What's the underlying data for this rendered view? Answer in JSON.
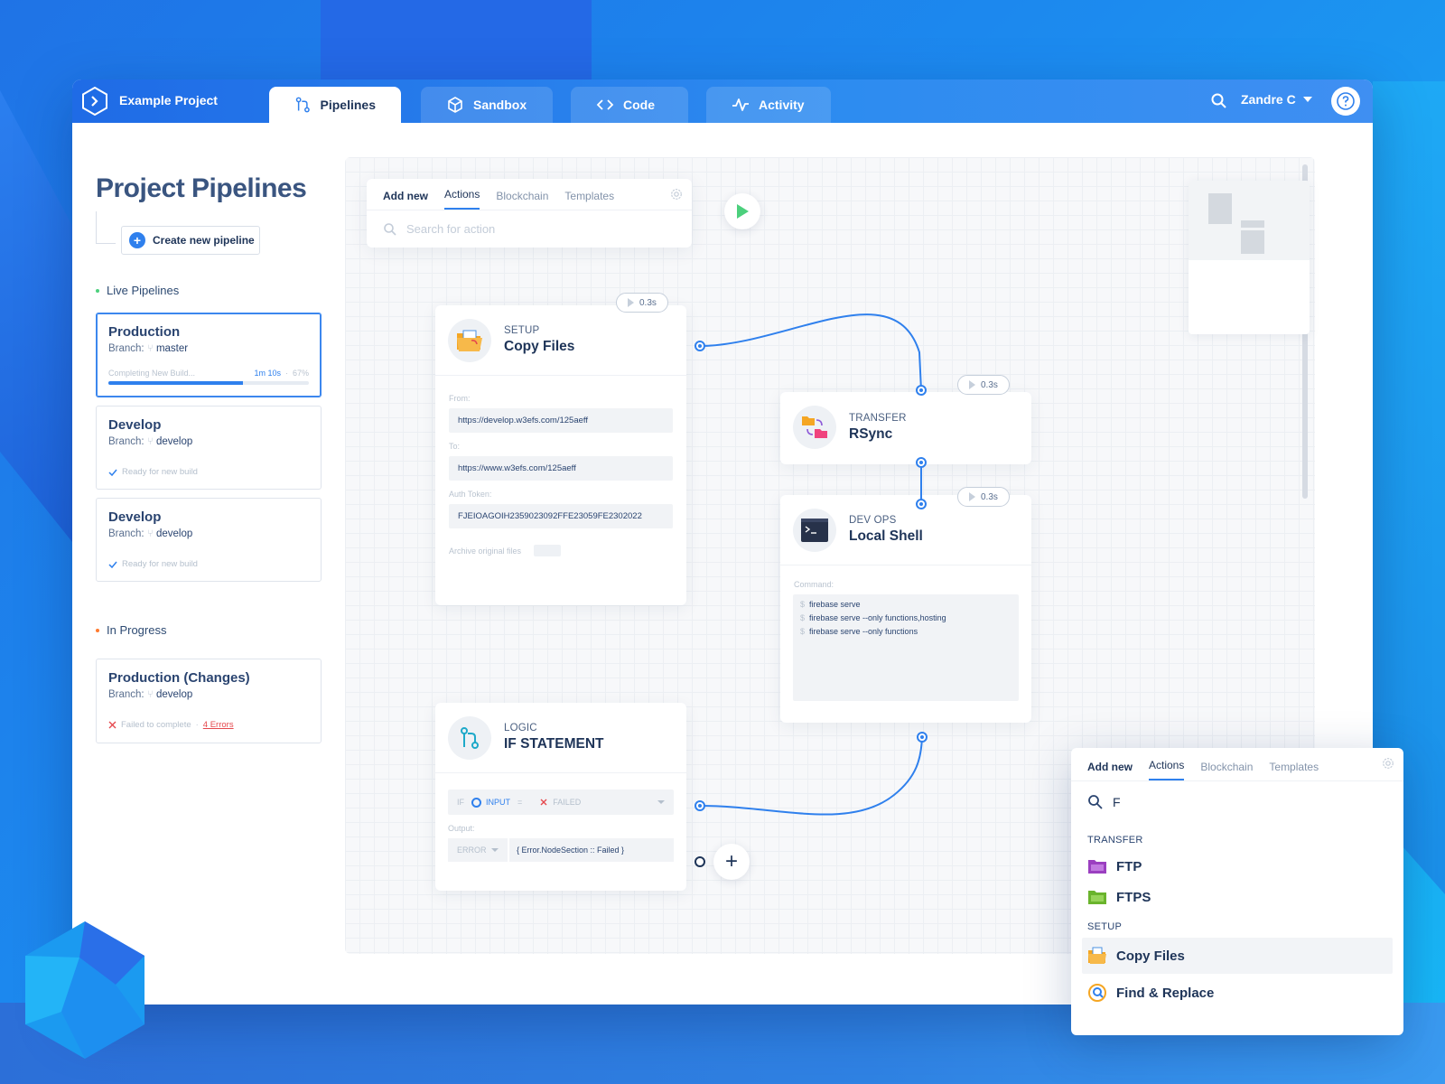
{
  "app": {
    "project_name": "Example Project",
    "tabs": [
      {
        "label": "Pipelines",
        "icon": "git-branch-icon",
        "active": true
      },
      {
        "label": "Sandbox",
        "icon": "cube-icon",
        "active": false
      },
      {
        "label": "Code",
        "icon": "code-icon",
        "active": false
      },
      {
        "label": "Activity",
        "icon": "activity-icon",
        "active": false
      }
    ],
    "user_name": "Zandre C"
  },
  "sidebar": {
    "title": "Project Pipelines",
    "create_label": "Create new pipeline",
    "live_label": "Live Pipelines",
    "progress_label": "In Progress",
    "branch_prefix": "Branch:",
    "live_pipelines": [
      {
        "name": "Production",
        "branch": "master",
        "status": "Completing New Build...",
        "time": "1m 10s",
        "percent_label": "67%",
        "progress": 0.67
      },
      {
        "name": "Develop",
        "branch": "develop",
        "status": "Ready for new build"
      },
      {
        "name": "Develop",
        "branch": "develop",
        "status": "Ready for new build"
      }
    ],
    "in_progress": [
      {
        "name": "Production (Changes)",
        "branch": "develop",
        "status": "Failed to complete",
        "errors": "4 Errors"
      }
    ]
  },
  "toolbox": {
    "tabs": [
      "Add new",
      "Actions",
      "Blockchain",
      "Templates"
    ],
    "selected_tab": "Actions",
    "search_placeholder": "Search for action"
  },
  "nodes": {
    "copy_files": {
      "category": "SETUP",
      "title": "Copy Files",
      "time": "0.3s",
      "from_label": "From:",
      "from_value": "https://develop.w3efs.com/125aeff",
      "to_label": "To:",
      "to_value": "https://www.w3efs.com/125aeff",
      "token_label": "Auth Token:",
      "token_value": "FJEIOAGOIH2359023092FFE23059FE2302022",
      "archive_label": "Archive original files"
    },
    "rsync": {
      "category": "TRANSFER",
      "title": "RSync",
      "time": "0.3s"
    },
    "local_shell": {
      "category": "DEV OPS",
      "title": "Local Shell",
      "time": "0.3s",
      "command_label": "Command:",
      "commands": [
        "firebase serve",
        "firebase serve --only functions,hosting",
        "firebase serve --only functions"
      ]
    },
    "if_statement": {
      "category": "LOGIC",
      "title": "IF STATEMENT",
      "if_label": "IF",
      "input_label": "INPUT",
      "eq": "=",
      "failed_label": "FAILED",
      "output_label": "Output:",
      "output_type": "ERROR",
      "output_value": "{ Error.NodeSection :: Failed }"
    }
  },
  "popup": {
    "tabs": [
      "Add new",
      "Actions",
      "Blockchain",
      "Templates"
    ],
    "selected_tab": "Actions",
    "query": "F",
    "groups": [
      {
        "label": "TRANSFER",
        "items": [
          "FTP",
          "FTPS"
        ]
      },
      {
        "label": "SETUP",
        "items": [
          "Copy Files",
          "Find & Replace"
        ]
      }
    ]
  },
  "colors": {
    "accent": "#2f80ed",
    "error": "#e5484d",
    "success": "#2f80ed",
    "live_dot": "#4cd07d",
    "progress_dot": "#ff7a2f"
  }
}
